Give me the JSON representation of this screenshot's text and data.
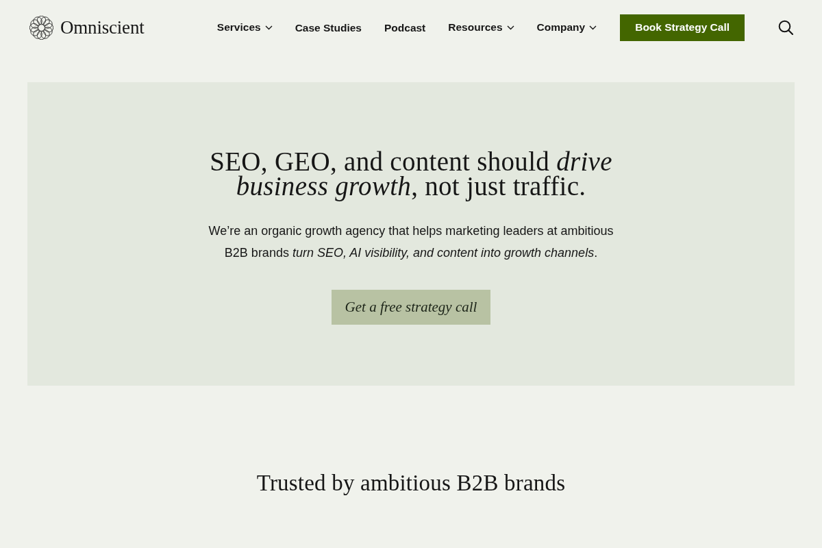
{
  "header": {
    "logo": {
      "name": "Omniscient"
    },
    "nav": [
      {
        "label": "Services",
        "has_menu": true
      },
      {
        "label": "Case Studies",
        "has_menu": false
      },
      {
        "label": "Podcast",
        "has_menu": false
      },
      {
        "label": "Resources",
        "has_menu": true
      },
      {
        "label": "Company",
        "has_menu": true
      }
    ],
    "cta": "Book Strategy Call"
  },
  "hero": {
    "headline": [
      "SEO, GEO, and content should *drive*",
      "*business growth*, not just traffic."
    ],
    "intro": "We’re an organic growth agency that helps marketing leaders at ambitious B2B brands *turn SEO, AI visibility, and content into growth channels*.",
    "button": "Get a free strategy call"
  },
  "trusted": {
    "title": "Trusted by ambitious B2B brands"
  }
}
